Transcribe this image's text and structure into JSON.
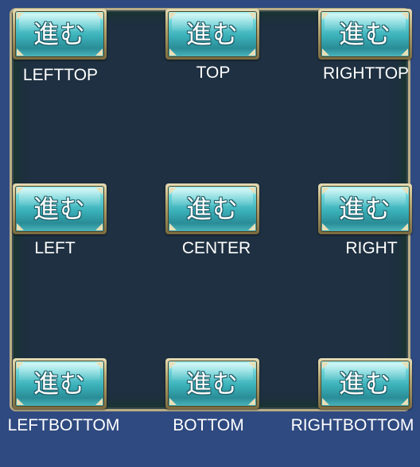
{
  "buttons": [
    {
      "id": "lefttop",
      "label": "進む",
      "caption": "LEFTTOP"
    },
    {
      "id": "top",
      "label": "進む",
      "caption": "TOP"
    },
    {
      "id": "righttop",
      "label": "進む",
      "caption": "RIGHTTOP"
    },
    {
      "id": "left",
      "label": "進む",
      "caption": "LEFT"
    },
    {
      "id": "center",
      "label": "進む",
      "caption": "CENTER"
    },
    {
      "id": "right",
      "label": "進む",
      "caption": "RIGHT"
    },
    {
      "id": "leftbottom",
      "label": "進む",
      "caption": "LEFTBOTTOM"
    },
    {
      "id": "bottom",
      "label": "進む",
      "caption": "BOTTOM"
    },
    {
      "id": "rightbottom",
      "label": "進む",
      "caption": "RIGHTBOTTOM"
    }
  ],
  "colors": {
    "background": "#2f4a80",
    "panel": "#1e3041",
    "panel_border": "#b9ad86",
    "button_face": "#3ab0b8",
    "button_frame": "#b6a671",
    "text": "#ffffff"
  }
}
